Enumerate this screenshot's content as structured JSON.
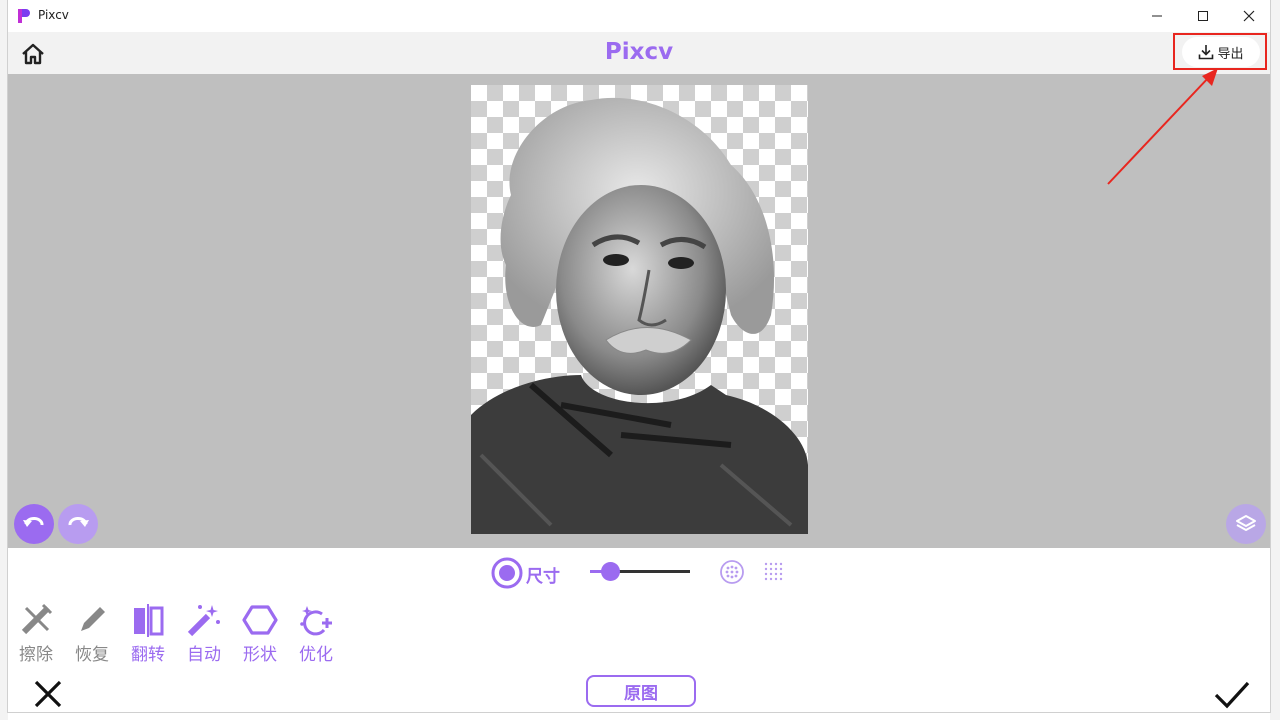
{
  "window": {
    "title": "Pixcv"
  },
  "header": {
    "brand": "Pixcv",
    "export_label": "导出"
  },
  "colors": {
    "accent": "#9b6bf0",
    "highlight": "#e8261f"
  },
  "controls": {
    "size_label": "尺寸",
    "brush_size": 0.2
  },
  "tools": [
    {
      "label": "擦除",
      "icon": "eraser-icon",
      "state": "inactive"
    },
    {
      "label": "恢复",
      "icon": "pencil-icon",
      "state": "inactive"
    },
    {
      "label": "翻转",
      "icon": "flip-icon",
      "state": "active"
    },
    {
      "label": "自动",
      "icon": "magic-wand-icon",
      "state": "active"
    },
    {
      "label": "形状",
      "icon": "hexagon-icon",
      "state": "active"
    },
    {
      "label": "优化",
      "icon": "sparkle-icon",
      "state": "active"
    }
  ],
  "footer": {
    "original_label": "原图"
  }
}
